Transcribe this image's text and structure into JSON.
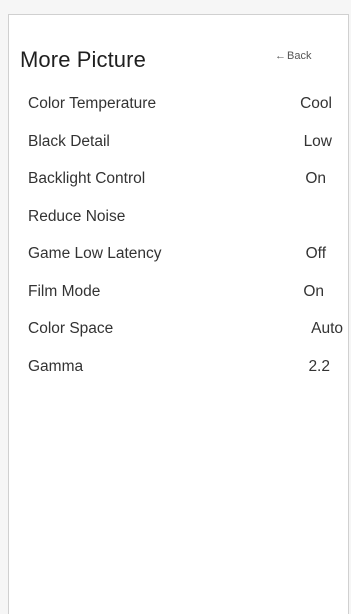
{
  "header": {
    "title": "More Picture",
    "back_label": "Back",
    "back_icon": "left-arrow-icon"
  },
  "menu": {
    "items": [
      {
        "label": "Color Temperature",
        "value": "Cool"
      },
      {
        "label": "Black Detail",
        "value": "Low"
      },
      {
        "label": "Backlight Control",
        "value": "On"
      },
      {
        "label": "Reduce Noise",
        "value": ""
      },
      {
        "label": "Game Low Latency",
        "value": "Off"
      },
      {
        "label": "Film Mode",
        "value": "On"
      },
      {
        "label": "Color Space",
        "value": "Auto"
      },
      {
        "label": "Gamma",
        "value": "2.2"
      }
    ]
  }
}
